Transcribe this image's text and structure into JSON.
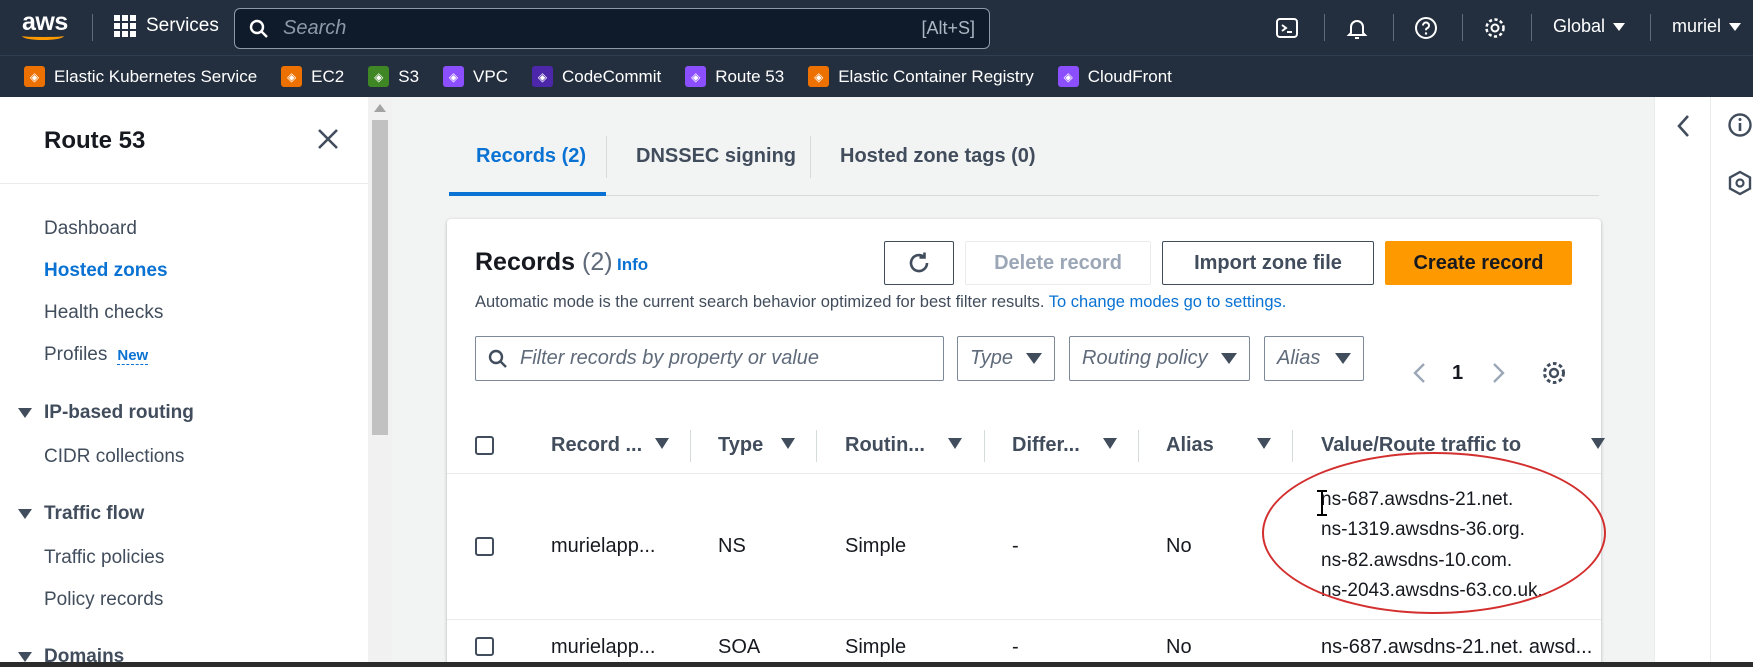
{
  "topnav": {
    "logo_text": "aws",
    "services_label": "Services",
    "search_placeholder": "Search",
    "search_shortcut": "[Alt+S]",
    "region_label": "Global",
    "user_label": "muriel"
  },
  "favorites": [
    {
      "label": "Elastic Kubernetes Service",
      "color": "#ed7100",
      "icon": "eks-icon"
    },
    {
      "label": "EC2",
      "color": "#ed7100",
      "icon": "ec2-icon"
    },
    {
      "label": "S3",
      "color": "#3f8624",
      "icon": "s3-icon"
    },
    {
      "label": "VPC",
      "color": "#8c4fff",
      "icon": "vpc-icon"
    },
    {
      "label": "CodeCommit",
      "color": "#4d27aa",
      "icon": "codecommit-icon"
    },
    {
      "label": "Route 53",
      "color": "#8c4fff",
      "icon": "route53-icon"
    },
    {
      "label": "Elastic Container Registry",
      "color": "#ed7100",
      "icon": "ecr-icon"
    },
    {
      "label": "CloudFront",
      "color": "#8c4fff",
      "icon": "cloudfront-icon"
    }
  ],
  "sidenav": {
    "title": "Route 53",
    "items": [
      {
        "label": "Dashboard"
      },
      {
        "label": "Hosted zones"
      },
      {
        "label": "Health checks"
      },
      {
        "label": "Profiles",
        "badge": "New"
      }
    ],
    "sections": [
      {
        "title": "IP-based routing",
        "items": [
          "CIDR collections"
        ]
      },
      {
        "title": "Traffic flow",
        "items": [
          "Traffic policies",
          "Policy records"
        ]
      },
      {
        "title": "Domains",
        "items": []
      }
    ]
  },
  "tabs": [
    {
      "label": "Records (2)",
      "active": true
    },
    {
      "label": "DNSSEC signing",
      "active": false
    },
    {
      "label": "Hosted zone tags (0)",
      "active": false
    }
  ],
  "records_panel": {
    "title": "Records",
    "count": "(2)",
    "info": "Info",
    "description": "Automatic mode is the current search behavior optimized for best filter results.",
    "description_link": "To change modes go to settings.",
    "buttons": {
      "delete": "Delete record",
      "import": "Import zone file",
      "create": "Create record"
    },
    "filter_placeholder": "Filter records by property or value",
    "dropdowns": {
      "type": "Type",
      "routing": "Routing policy",
      "alias": "Alias"
    },
    "page_number": "1"
  },
  "table": {
    "columns": [
      "Record ...",
      "Type",
      "Routin...",
      "Differ...",
      "Alias",
      "Value/Route traffic to"
    ],
    "rows": [
      {
        "name": "murielapp...",
        "type": "NS",
        "routing": "Simple",
        "differ": "-",
        "alias": "No",
        "values": [
          "ns-687.awsdns-21.net.",
          "ns-1319.awsdns-36.org.",
          "ns-82.awsdns-10.com.",
          "ns-2043.awsdns-63.co.uk."
        ]
      },
      {
        "name": "murielapp...",
        "type": "SOA",
        "routing": "Simple",
        "differ": "-",
        "alias": "No",
        "values": [
          "ns-687.awsdns-21.net. awsd..."
        ]
      }
    ]
  },
  "colors": {
    "nav_bg": "#232f3e",
    "accent": "#0972d3",
    "primary_button": "#ff9900",
    "annotation": "#d32f2f"
  }
}
